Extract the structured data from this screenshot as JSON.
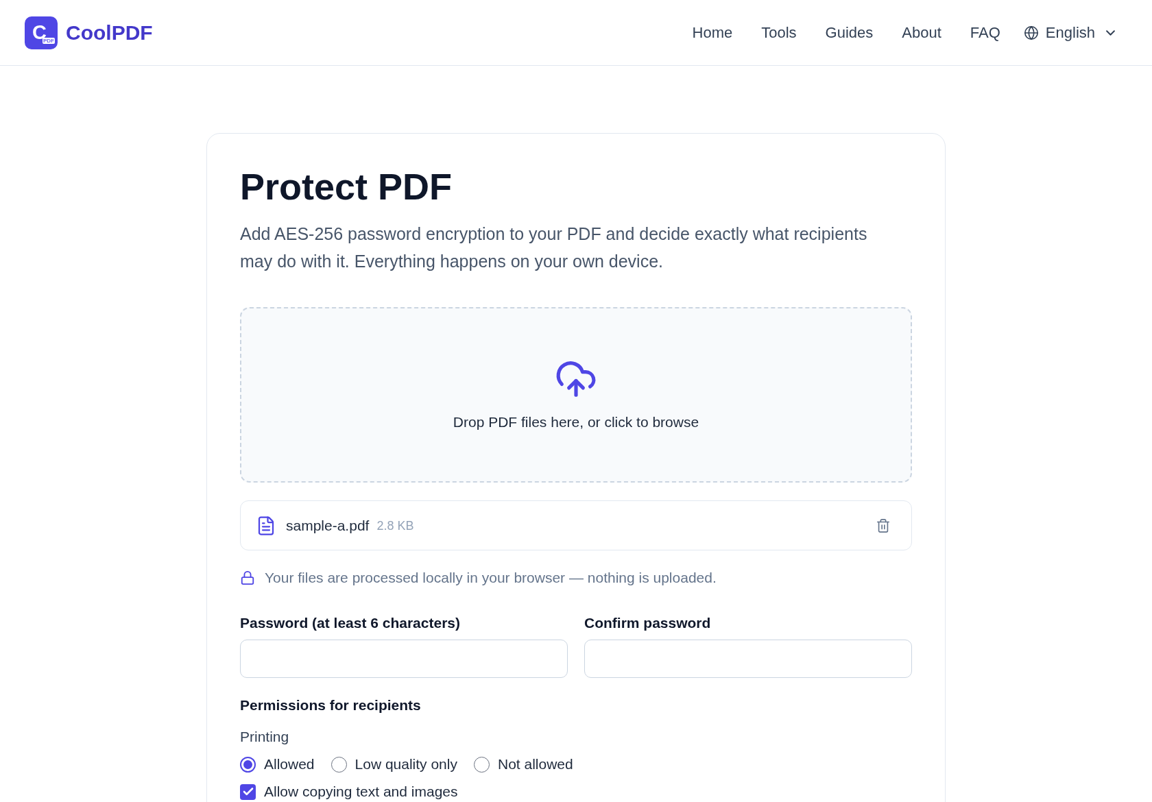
{
  "header": {
    "logo": {
      "mark": "C",
      "badge": "PDF",
      "name": "CoolPDF"
    },
    "nav": [
      "Home",
      "Tools",
      "Guides",
      "About",
      "FAQ"
    ],
    "language": "English"
  },
  "tool": {
    "title": "Protect PDF",
    "description": "Add AES-256 password encryption to your PDF and decide exactly what recipients may do with it. Everything happens on your own device.",
    "dropzone": {
      "text": "Drop PDF files here, or click to browse"
    },
    "files": [
      {
        "name": "sample-a.pdf",
        "size": "2.8 KB"
      }
    ],
    "privacy_note": "Your files are processed locally in your browser — nothing is uploaded.",
    "password_fields": [
      {
        "label": "Password (at least 6 characters)"
      },
      {
        "label": "Confirm password"
      }
    ],
    "permissions": {
      "heading": "Permissions for recipients",
      "printing": {
        "label": "Printing",
        "options": [
          {
            "label": "Allowed",
            "selected": true
          },
          {
            "label": "Low quality only",
            "selected": false
          },
          {
            "label": "Not allowed",
            "selected": false
          }
        ]
      },
      "toggles": [
        {
          "label": "Allow copying text and images",
          "checked": true
        }
      ]
    }
  }
}
